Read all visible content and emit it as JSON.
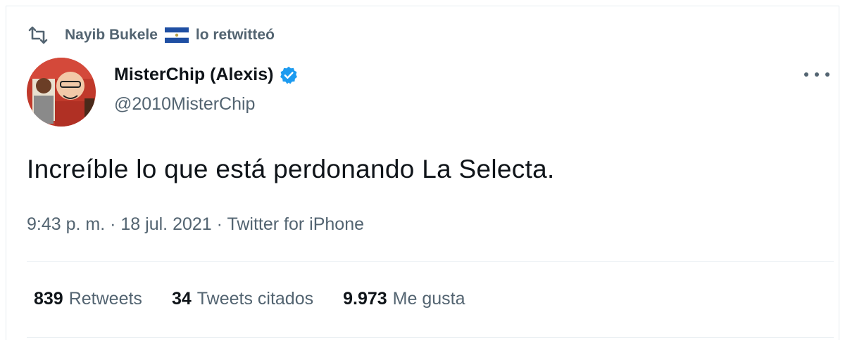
{
  "retweet": {
    "user": "Nayib Bukele",
    "flag_icon": "el-salvador-flag-icon",
    "action": "lo retwitteó"
  },
  "author": {
    "name": "MisterChip (Alexis)",
    "verified": true,
    "handle": "@2010MisterChip"
  },
  "tweet": {
    "text": "Increíble lo que está perdonando La Selecta.",
    "time": "9:43 p. m.",
    "date": "18 jul. 2021",
    "source": "Twitter for iPhone",
    "separator": "·"
  },
  "stats": {
    "retweets_count": "839",
    "retweets_label": "Retweets",
    "quotes_count": "34",
    "quotes_label": "Tweets citados",
    "likes_count": "9.973",
    "likes_label": "Me gusta"
  },
  "colors": {
    "text": "#0f1419",
    "secondary": "#536471",
    "verified": "#1d9bf0",
    "border": "#e6ecf0",
    "avatar_bg": "#c0392b"
  }
}
